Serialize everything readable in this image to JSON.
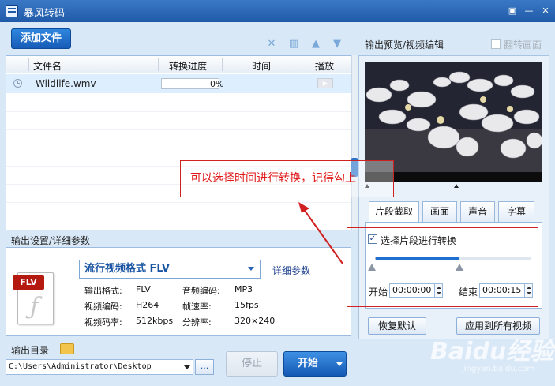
{
  "window": {
    "title": "暴风转码"
  },
  "toolbar": {
    "add_file_label": "添加文件"
  },
  "file_list": {
    "columns": [
      "文件名",
      "转换进度",
      "时间",
      "播放"
    ],
    "rows": [
      {
        "name": "Wildlife.wmv",
        "progress_text": "0%",
        "progress": 0
      }
    ]
  },
  "output_settings": {
    "section_label": "输出设置/详细参数",
    "format_name": "流行视频格式 FLV",
    "detail_link": "详细参数",
    "file_tag": "FLV",
    "fields": [
      {
        "label": "输出格式:",
        "value": "FLV"
      },
      {
        "label": "音频编码:",
        "value": "MP3"
      },
      {
        "label": "视频编码:",
        "value": "H264"
      },
      {
        "label": "帧速率:",
        "value": "15fps"
      },
      {
        "label": "视频码率:",
        "value": "512kbps"
      },
      {
        "label": "分辨率:",
        "value": "320×240"
      }
    ]
  },
  "output_dir": {
    "label": "输出目录",
    "path": "C:\\Users\\Administrator\\Desktop",
    "browse_label": "..."
  },
  "actions": {
    "stop_label": "停止",
    "start_label": "开始"
  },
  "preview": {
    "title": "输出预览/视频编辑",
    "flip_label": "翻转画面",
    "tabs": [
      "片段截取",
      "画面",
      "声音",
      "字幕"
    ],
    "segment_checkbox_label": "选择片段进行转换",
    "segment_progress": 0.54,
    "start_label": "开始",
    "start_time": "00:00:00",
    "end_label": "结束",
    "end_time": "00:00:15",
    "reset_label": "恢复默认",
    "apply_all_label": "应用到所有视频"
  },
  "annotation": {
    "text": "可以选择时间进行转换，记得勾上"
  },
  "watermark": {
    "brand": "Baidu经验",
    "url": "jingyan.baidu.com"
  },
  "colors": {
    "accent": "#1f6fd0",
    "annotation": "#e01818",
    "title_bar": "#2b66b5"
  }
}
